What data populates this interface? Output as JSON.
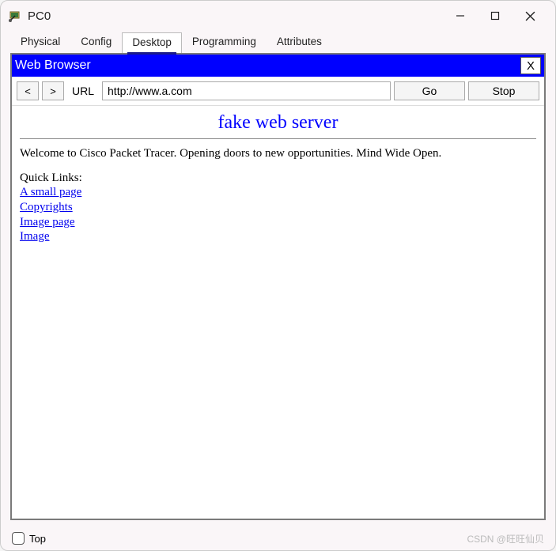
{
  "window": {
    "title": "PC0"
  },
  "tabs": {
    "items": [
      "Physical",
      "Config",
      "Desktop",
      "Programming",
      "Attributes"
    ],
    "active_index": 2
  },
  "browser": {
    "header_title": "Web Browser",
    "close_label": "X",
    "back_label": "<",
    "forward_label": ">",
    "url_label": "URL",
    "url_value": "http://www.a.com",
    "go_label": "Go",
    "stop_label": "Stop"
  },
  "page": {
    "title": "fake web server",
    "welcome": "Welcome to Cisco Packet Tracer. Opening doors to new opportunities. Mind Wide Open.",
    "quick_links_label": "Quick Links:",
    "links": [
      "A small page",
      "Copyrights",
      "Image page",
      "Image"
    ]
  },
  "footer": {
    "top_label": "Top"
  },
  "watermark": "CSDN @旺旺仙贝"
}
